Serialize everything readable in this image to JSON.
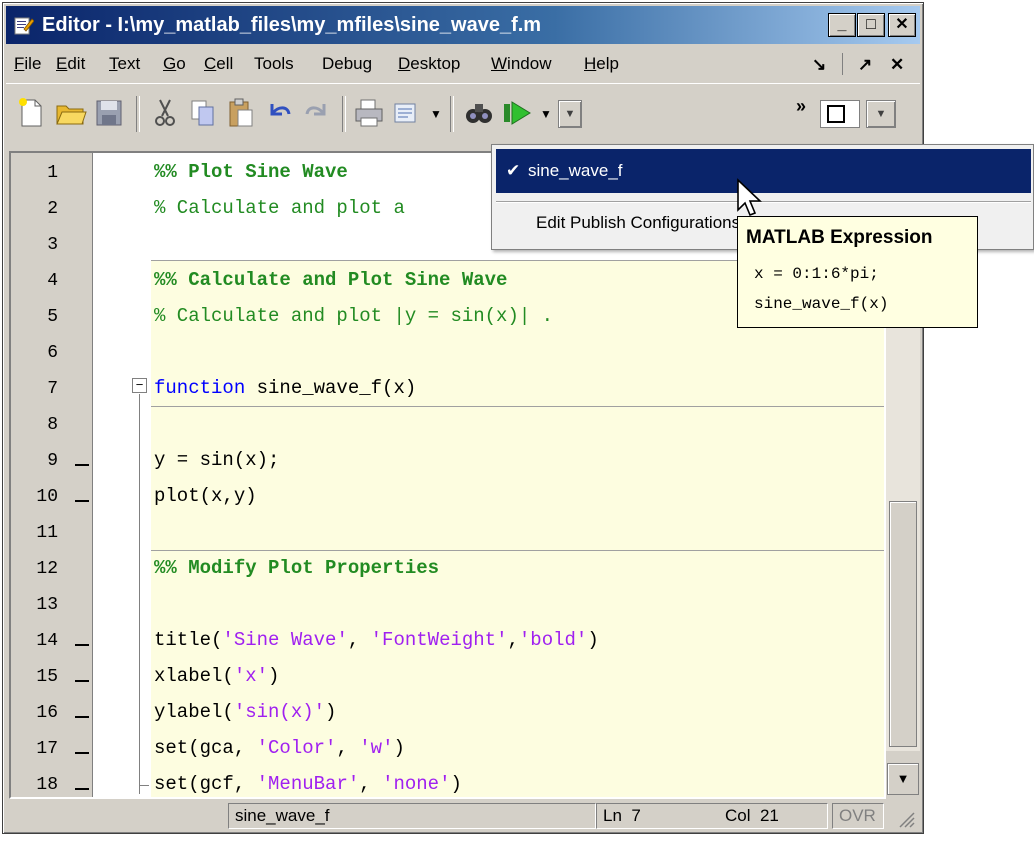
{
  "window": {
    "title": "Editor - I:\\my_matlab_files\\my_mfiles\\sine_wave_f.m",
    "min_label": "_",
    "max_label": "□",
    "close_label": "✕"
  },
  "menubar": {
    "items": [
      {
        "label": "File",
        "ul": "F",
        "rest": "ile"
      },
      {
        "label": "Edit",
        "ul": "E",
        "rest": "dit"
      },
      {
        "label": "Text",
        "ul": "T",
        "rest": "ext"
      },
      {
        "label": "Go",
        "ul": "G",
        "rest": "o"
      },
      {
        "label": "Cell",
        "ul": "C",
        "rest": "ell"
      },
      {
        "label": "Tools",
        "ul": "",
        "rest": "Tools"
      },
      {
        "label": "Debug",
        "ul": "",
        "rest": "Debug"
      },
      {
        "label": "Desktop",
        "ul": "D",
        "rest": "esktop"
      },
      {
        "label": "Window",
        "ul": "W",
        "rest": "indow"
      },
      {
        "label": "Help",
        "ul": "H",
        "rest": "elp"
      }
    ],
    "dock_label": "↘",
    "undock_label": "↗",
    "close_label": "✕"
  },
  "toolbar": {
    "overflow_label": "»"
  },
  "editor": {
    "line_numbers": [
      "1",
      "2",
      "3",
      "4",
      "5",
      "6",
      "7",
      "8",
      "9",
      "10",
      "11",
      "12",
      "13",
      "14",
      "15",
      "16",
      "17",
      "18"
    ],
    "lines": {
      "l1": "%% Plot Sine Wave",
      "l2": "% Calculate and plot a",
      "l4": "%% Calculate and Plot Sine Wave",
      "l5": "% Calculate and plot |y = sin(x)| .",
      "l7_kw": "function",
      "l7_rest": " sine_wave_f(x)",
      "l9": "y = sin(x);",
      "l10": "plot(x,y)",
      "l12": "%% Modify Plot Properties",
      "l14_a": "title(",
      "l14_b": "'Sine Wave'",
      "l14_c": ", ",
      "l14_d": "'FontWeight'",
      "l14_e": ",",
      "l14_f": "'bold'",
      "l14_g": ")",
      "l15_a": "xlabel(",
      "l15_b": "'x'",
      "l15_c": ")",
      "l16_a": "ylabel(",
      "l16_b": "'sin(x)'",
      "l16_c": ")",
      "l17_a": "set(gca, ",
      "l17_b": "'Color'",
      "l17_c": ", ",
      "l17_d": "'w'",
      "l17_e": ")",
      "l18_a": "set(gcf, ",
      "l18_b": "'MenuBar'",
      "l18_c": ", ",
      "l18_d": "'none'",
      "l18_e": ")"
    }
  },
  "statusbar": {
    "function_name": "sine_wave_f",
    "ln_label": "Ln",
    "ln_value": "7",
    "col_label": "Col",
    "col_value": "21",
    "ovr": "OVR"
  },
  "publish_menu": {
    "selected_item": "sine_wave_f",
    "check": "✔",
    "edit_item": "Edit Publish Configurations for sine_wave_f...",
    "ellipsis": "..."
  },
  "tooltip": {
    "title": "MATLAB Expression",
    "line1": "x = 0:1:6*pi;",
    "line2": "sine_wave_f(x)"
  },
  "colors": {
    "comment": "#228b22",
    "keyword": "#0000ff",
    "string": "#a020f0",
    "cell_bg": "#fdfde0",
    "selection": "#0a246a"
  }
}
